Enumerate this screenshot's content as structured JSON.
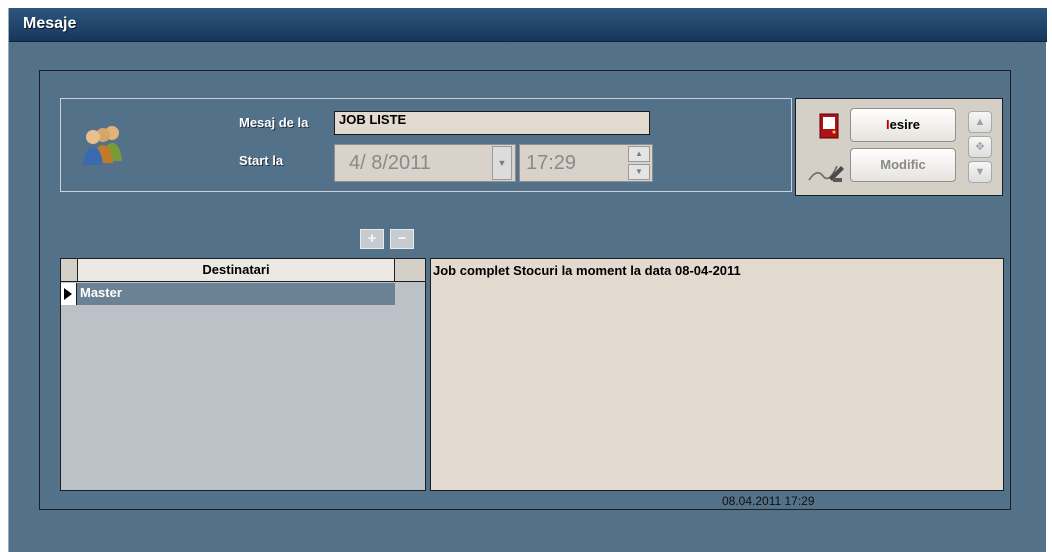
{
  "window": {
    "title": "Mesaje"
  },
  "form": {
    "sender_label": "Mesaj de la",
    "sender_value": "JOB LISTE",
    "start_label": "Start la",
    "start_date": "4/ 8/2011",
    "start_time": "17:29"
  },
  "actions": {
    "exit_label_hot": "I",
    "exit_label_rest": "esire",
    "modify_label": "Modific"
  },
  "recipients": {
    "header": "Destinatari",
    "rows": [
      "Master"
    ]
  },
  "message": {
    "text": "Job complet Stocuri  la moment la data 08-04-2011",
    "timestamp": "08.04.2011 17:29"
  },
  "colors": {
    "accent": "#c00000",
    "selection": "#6b8294",
    "background": "#54718a"
  }
}
